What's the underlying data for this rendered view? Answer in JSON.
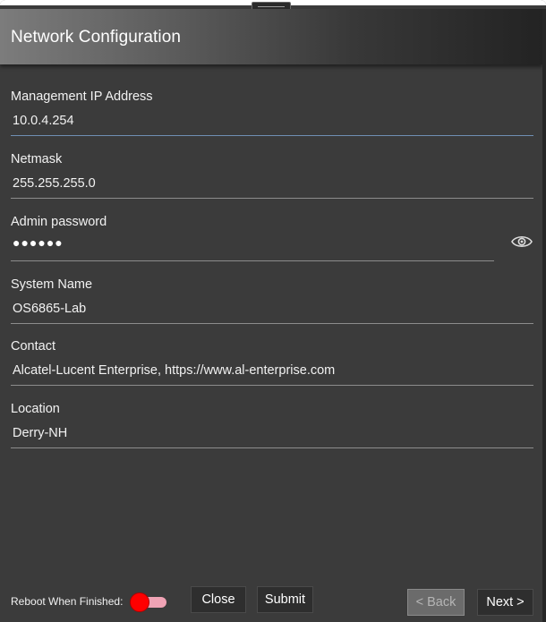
{
  "window": {
    "title": "Network Configuration"
  },
  "fields": {
    "management_ip": {
      "label": "Management IP Address",
      "value": "10.0.4.254"
    },
    "netmask": {
      "label": "Netmask",
      "value": "255.255.255.0"
    },
    "admin_password": {
      "label": "Admin password",
      "masked_value": "●●●●●●"
    },
    "system_name": {
      "label": "System Name",
      "value": "OS6865-Lab"
    },
    "contact": {
      "label": "Contact",
      "value": "Alcatel-Lucent Enterprise, https://www.al-enterprise.com"
    },
    "location": {
      "label": "Location",
      "value": "Derry-NH"
    }
  },
  "footer": {
    "reboot_label": "Reboot When Finished:",
    "reboot_enabled": true,
    "toggle_color": "#ff0000",
    "close_label": "Close",
    "submit_label": "Submit",
    "back_label": "< Back",
    "back_disabled": true,
    "next_label": "Next >"
  },
  "icons": {
    "password_toggle": "eye-icon",
    "drag_handle": "grip-icon"
  }
}
